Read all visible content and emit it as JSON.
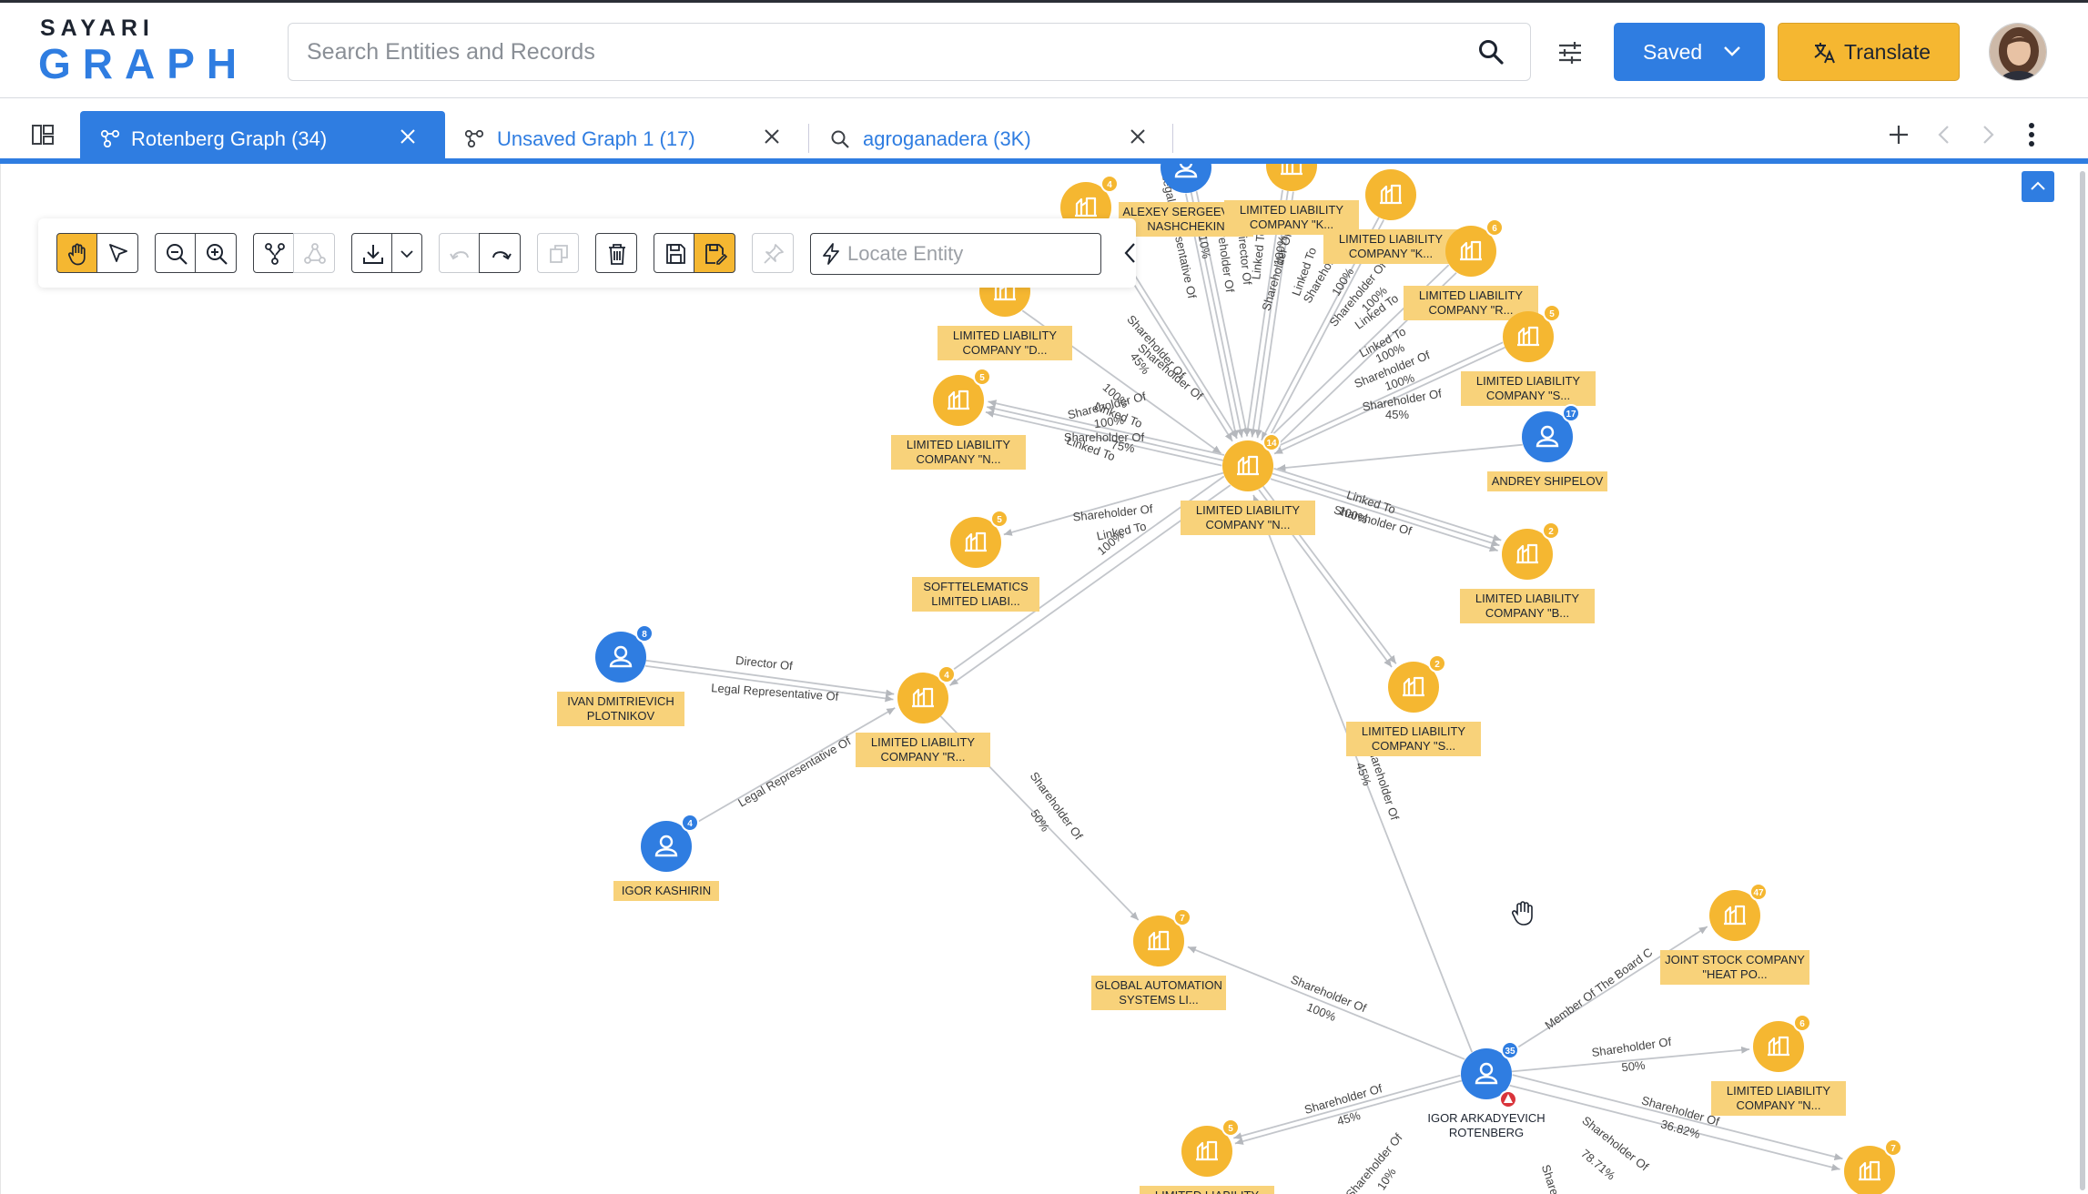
{
  "brand": {
    "line1": "SAYARI",
    "line2": "GRAPH"
  },
  "search": {
    "placeholder": "Search Entities and Records"
  },
  "header": {
    "saved_label": "Saved",
    "translate_label": "Translate"
  },
  "tabs": [
    {
      "label": "Rotenberg Graph (34)",
      "active": true,
      "icon": "graph-icon"
    },
    {
      "label": "Unsaved Graph 1 (17)",
      "active": false,
      "icon": "graph-icon"
    },
    {
      "label": "agroganadera (3K)",
      "active": false,
      "icon": "search-icon"
    }
  ],
  "toolbar": {
    "locate_placeholder": "Locate Entity",
    "tools": [
      "pan-tool",
      "select-tool",
      "zoom-out",
      "zoom-in",
      "expand",
      "collapse-nodes",
      "download",
      "download-options",
      "undo",
      "redo",
      "copy",
      "delete",
      "save",
      "save-as",
      "pin"
    ]
  },
  "colors": {
    "accent": "#2f7de1",
    "company": "#f5b731",
    "person": "#2f7de1",
    "label_bg": "#f8d27a",
    "edge": "#c3c6cb"
  },
  "graph": {
    "nodes": [
      {
        "id": "n_top1",
        "type": "company",
        "count": "4",
        "line1": "",
        "line2": ""
      },
      {
        "id": "n_alexey",
        "type": "person",
        "count": "",
        "line1": "ALEXEY SERGEEVICH",
        "line2": "NASHCHEKIN"
      },
      {
        "id": "n_topk",
        "type": "company",
        "count": "",
        "line1": "LIMITED LIABILITY",
        "line2": "COMPANY \"K..."
      },
      {
        "id": "n_k2",
        "type": "company",
        "count": "",
        "line1": "LIMITED LIABILITY",
        "line2": "COMPANY \"K..."
      },
      {
        "id": "n_r1",
        "type": "company",
        "count": "6",
        "line1": "LIMITED LIABILITY",
        "line2": "COMPANY \"R..."
      },
      {
        "id": "n_d",
        "type": "company",
        "count": "",
        "line1": "LIMITED LIABILITY",
        "line2": "COMPANY \"D..."
      },
      {
        "id": "n_s1",
        "type": "company",
        "count": "5",
        "line1": "LIMITED LIABILITY",
        "line2": "COMPANY \"S..."
      },
      {
        "id": "n_n1",
        "type": "company",
        "count": "5",
        "line1": "LIMITED LIABILITY",
        "line2": "COMPANY \"N..."
      },
      {
        "id": "n_andrey",
        "type": "person",
        "count": "17",
        "line1": "ANDREY SHIPELOV",
        "line2": ""
      },
      {
        "id": "n_center",
        "type": "company",
        "count": "14",
        "line1": "LIMITED LIABILITY",
        "line2": "COMPANY \"N..."
      },
      {
        "id": "n_soft",
        "type": "company",
        "count": "5",
        "line1": "SOFTTELEMATICS",
        "line2": "LIMITED LIABI..."
      },
      {
        "id": "n_b",
        "type": "company",
        "count": "2",
        "line1": "LIMITED LIABILITY",
        "line2": "COMPANY \"B..."
      },
      {
        "id": "n_ivan",
        "type": "person",
        "count": "8",
        "line1": "IVAN DMITRIEVICH",
        "line2": "PLOTNIKOV"
      },
      {
        "id": "n_r2",
        "type": "company",
        "count": "4",
        "line1": "LIMITED LIABILITY",
        "line2": "COMPANY \"R..."
      },
      {
        "id": "n_s2",
        "type": "company",
        "count": "2",
        "line1": "LIMITED LIABILITY",
        "line2": "COMPANY \"S..."
      },
      {
        "id": "n_igor_k",
        "type": "person",
        "count": "4",
        "line1": "IGOR KASHIRIN",
        "line2": ""
      },
      {
        "id": "n_global",
        "type": "company",
        "count": "7",
        "line1": "GLOBAL AUTOMATION",
        "line2": "SYSTEMS LI..."
      },
      {
        "id": "n_jsc",
        "type": "company",
        "count": "47",
        "line1": "JOINT STOCK COMPANY",
        "line2": "\"HEAT PO..."
      },
      {
        "id": "n_rotenberg",
        "type": "person",
        "count": "35",
        "line1": "IGOR ARKADYEVICH",
        "line2": "ROTENBERG"
      },
      {
        "id": "n_n2",
        "type": "company",
        "count": "6",
        "line1": "LIMITED LIABILITY",
        "line2": "COMPANY \"N..."
      },
      {
        "id": "n_bl",
        "type": "company",
        "count": "5",
        "line1": "LIMITED LIABILITY",
        "line2": ""
      },
      {
        "id": "n_br",
        "type": "company",
        "count": "7",
        "line1": "",
        "line2": ""
      }
    ],
    "edge_labels": [
      "Legal Representative Of",
      "10%",
      "Shareholder Of",
      "Director Of",
      "Linked To",
      "100%",
      "Shareholder Of",
      "Linked To",
      "Shareholder Of",
      "100%",
      "Shareholder Of",
      "100%",
      "Linked To",
      "Linked To",
      "100%",
      "Shareholder Of",
      "100%",
      "Shareholder Of",
      "45%",
      "Shareholder Of",
      "45%",
      "Shareholder Of",
      "100%",
      "Linked To",
      "Shareholder Of",
      "75%",
      "Shareholder Of",
      "100%",
      "Linked To",
      "Linked To",
      "Shareholder Of",
      "100%",
      "Linked To",
      "Shareholder Of",
      "100%",
      "Director Of",
      "Legal Representative Of",
      "Legal Representative Of",
      "Shareholder Of",
      "50%",
      "Shareholder Of",
      "100%",
      "45%",
      "Shareholder Of",
      "Member Of The Board C",
      "Shareholder Of",
      "50%",
      "Shareholder Of",
      "36.82%",
      "Shareholder Of",
      "45%",
      "Shareholder Of",
      "78.71%",
      "Shareholder Of",
      "10%",
      "Share"
    ]
  }
}
